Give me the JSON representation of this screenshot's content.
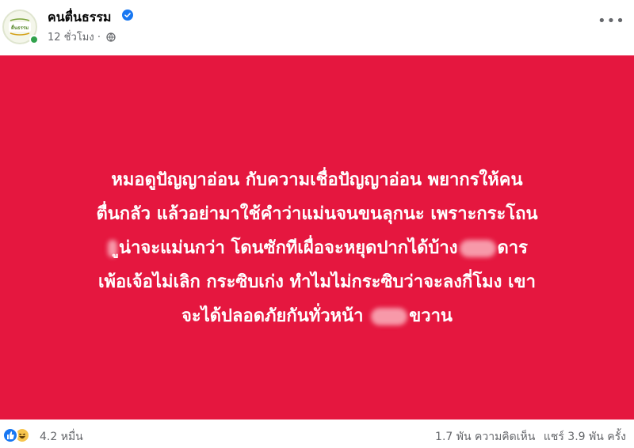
{
  "header": {
    "page_name": "คนตื่นธรรม",
    "time_ago": "12 ชั่วโมง",
    "separator": "·",
    "privacy_icon": "globe-icon",
    "verified_icon": "verified-badge-icon",
    "more_label": "•••",
    "avatar_text": "คนตื่นธรรม"
  },
  "post": {
    "background_color": "#e5173f",
    "text_color": "#ffffff",
    "line1": "หมอดูปัญญาอ่อน กับความเชื่อปัญญาอ่อน พยากรให้คน",
    "line2": "ตื่นกลัว แล้วอย่ามาใช้คำว่าแม่นจนขนลุกนะ เพราะกระโถน",
    "line3_after_censor": "ูน่าจะแม่นกว่า โดนซักทีเผื่อจะหยุดปากได้บ้าง",
    "line3_end": "ดาร",
    "line4": "เพ้อเจ้อไม่เลิก กระซิบเก่ง ทำไมไม่กระซิบว่าจะลงกี่โมง เขา",
    "line5": "จะได้ปลอดภัยกันทั่วหน้า",
    "line5_end": "ขวาน"
  },
  "footer": {
    "reaction_icons": [
      "like-icon",
      "haha-icon"
    ],
    "reaction_count": "4.2 หมื่น",
    "comments": "1.7 พัน ความคิดเห็น",
    "shares": "แชร์ 3.9 พัน ครั้ง"
  }
}
